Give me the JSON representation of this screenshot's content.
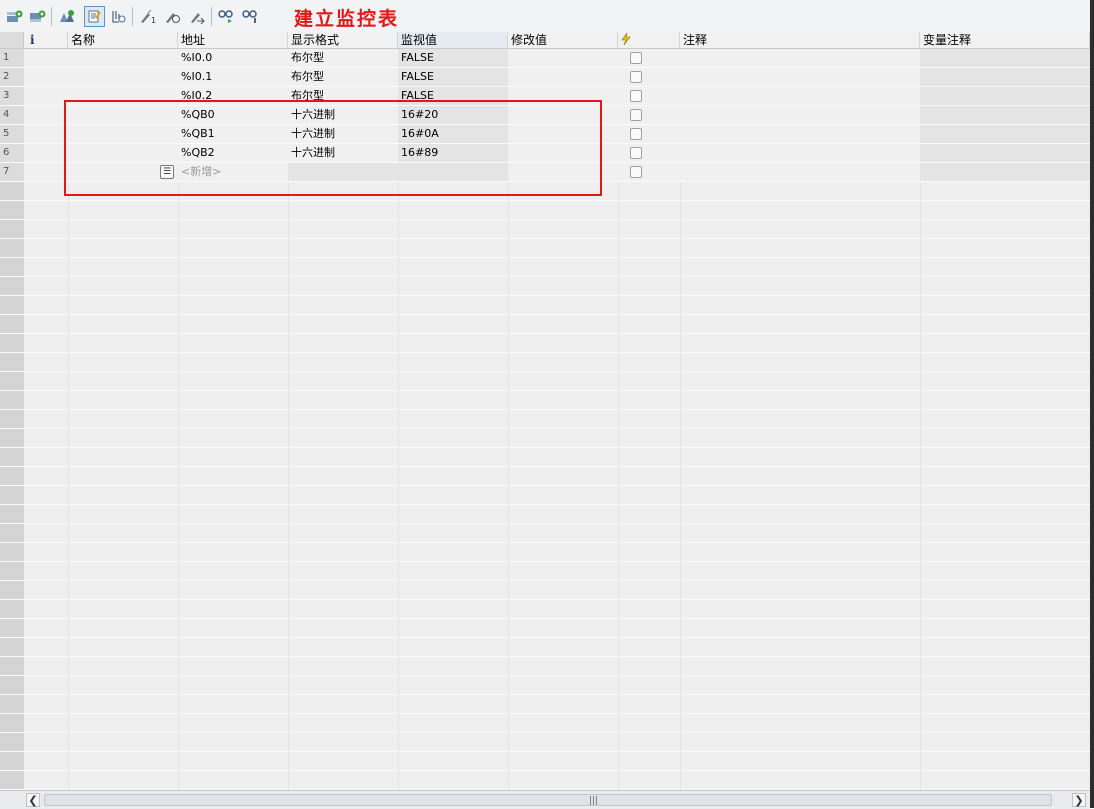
{
  "annotation_title": "建立监控表",
  "toolbar": {
    "icons": [
      "insert-row-icon",
      "add-row-icon",
      "force-values-icon",
      "monitor-all-icon",
      "monitor-once-icon",
      "modify-now-icon",
      "modify-trigger-icon",
      "enable-peripheral-icon",
      "show-force-icon",
      "hide-force-icon"
    ],
    "active_icon": "monitor-all-icon"
  },
  "columns": [
    "i",
    "名称",
    "地址",
    "显示格式",
    "监视值",
    "修改值",
    "⚡",
    "注释",
    "变量注释"
  ],
  "rows": [
    {
      "num": "1",
      "name": "",
      "address": "%I0.0",
      "format": "布尔型",
      "monitor": "FALSE",
      "modify": "",
      "comment": ""
    },
    {
      "num": "2",
      "name": "",
      "address": "%I0.1",
      "format": "布尔型",
      "monitor": "FALSE",
      "modify": "",
      "comment": ""
    },
    {
      "num": "3",
      "name": "",
      "address": "%I0.2",
      "format": "布尔型",
      "monitor": "FALSE",
      "modify": "",
      "comment": ""
    },
    {
      "num": "4",
      "name": "",
      "address": "%QB0",
      "format": "十六进制",
      "monitor": "16#20",
      "modify": "",
      "comment": ""
    },
    {
      "num": "5",
      "name": "",
      "address": "%QB1",
      "format": "十六进制",
      "monitor": "16#0A",
      "modify": "",
      "comment": ""
    },
    {
      "num": "6",
      "name": "",
      "address": "%QB2",
      "format": "十六进制",
      "monitor": "16#89",
      "modify": "",
      "comment": ""
    }
  ],
  "new_row": {
    "num": "7",
    "placeholder": "<新增>"
  },
  "accent_colors": {
    "annotation": "#e01818"
  }
}
